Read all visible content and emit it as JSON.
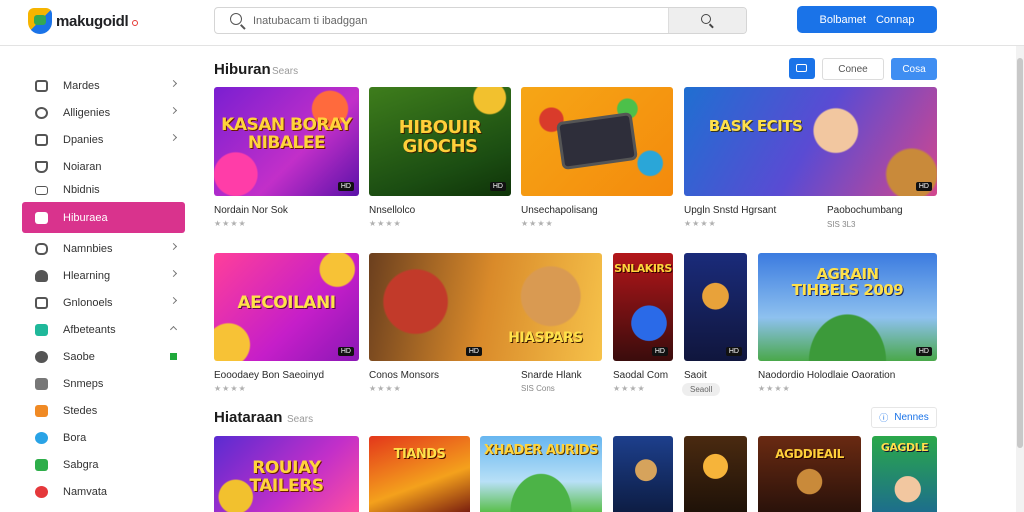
{
  "header": {
    "logo_text": "makugoidl",
    "search_placeholder": "Inatubacam ti ibadggan",
    "cta_label_1": "Bolbamet",
    "cta_label_2": "Connap"
  },
  "sidebar": {
    "items": [
      {
        "label": "Mardes"
      },
      {
        "label": "Alligenies"
      },
      {
        "label": "Dpanies"
      },
      {
        "label": "Noiaran"
      },
      {
        "label": "Nbidnis"
      },
      {
        "label": "Hiburaea"
      },
      {
        "label": "Namnbies"
      },
      {
        "label": "Hlearning"
      },
      {
        "label": "Gnlonoels"
      },
      {
        "label": "Afbeteants"
      },
      {
        "label": "Saobe"
      },
      {
        "label": "Snmeps"
      },
      {
        "label": "Stedes"
      },
      {
        "label": "Bora"
      },
      {
        "label": "Sabgra"
      },
      {
        "label": "Namvata"
      }
    ]
  },
  "section1": {
    "title": "Hiburan",
    "subtitle": "Sears",
    "btn_ghost": "Conee",
    "btn_primary": "Cosa"
  },
  "section2": {
    "title": "Hiataraan",
    "subtitle": "Sears",
    "more_label": "Nennes"
  },
  "cards_row1": [
    {
      "title_art": "KASAN BORAY NIBALEE",
      "name": "Nordain Nor Sok",
      "stars": "★★★★",
      "tag": "HD"
    },
    {
      "title_art": "HIBOUIR GIOCHS",
      "name": "Nnsellolco",
      "stars": "★★★★",
      "tag": "HD"
    },
    {
      "title_art": "",
      "name": "Unsechapolisang",
      "stars": "★★★★",
      "tag": ""
    },
    {
      "title_art": "BASK ECITS",
      "name": "Upgln Snstd Hgrsant",
      "stars": "★★★★",
      "tag": "HD"
    },
    {
      "title_art": "",
      "name": "Paobochumbang",
      "meta": "SIS 3L3",
      "tag": ""
    }
  ],
  "cards_row2": [
    {
      "title_art": "AECOILANI",
      "name": "Eooodaey Bon Saeoinyd",
      "stars": "★★★★",
      "tag": "HD"
    },
    {
      "title_art": "HIASPARS",
      "name": "Conos Monsors",
      "stars": "★★★★",
      "tag": "HD"
    },
    {
      "title_art": "",
      "name": "Snarde Hlank",
      "meta": "SIS Cons",
      "tag": ""
    },
    {
      "title_art": "SNLAKIRS",
      "name": "Saodal Com",
      "stars": "★★★★",
      "tag": "HD"
    },
    {
      "title_art": "",
      "name": "Saoit",
      "chip": "Seaoll",
      "tag": "HD"
    },
    {
      "title_art": "AGRAIN TIHBELS 2009",
      "name": "Naodordio Holodlaie Oaoration",
      "stars": "★★★★",
      "tag": "HD"
    }
  ],
  "cards_row3": [
    {
      "title_art": "ROUIAY TAILERS"
    },
    {
      "title_art": "TIANDS"
    },
    {
      "title_art": "XHADER AURIDS"
    },
    {
      "title_art": ""
    },
    {
      "title_art": ""
    },
    {
      "title_art": "AGDDIEAIL"
    },
    {
      "title_art": "GAGDLE"
    }
  ],
  "colors": {
    "accent": "#1a73e8",
    "active_nav": "#d9338d",
    "status_green": "#1fa93a"
  }
}
